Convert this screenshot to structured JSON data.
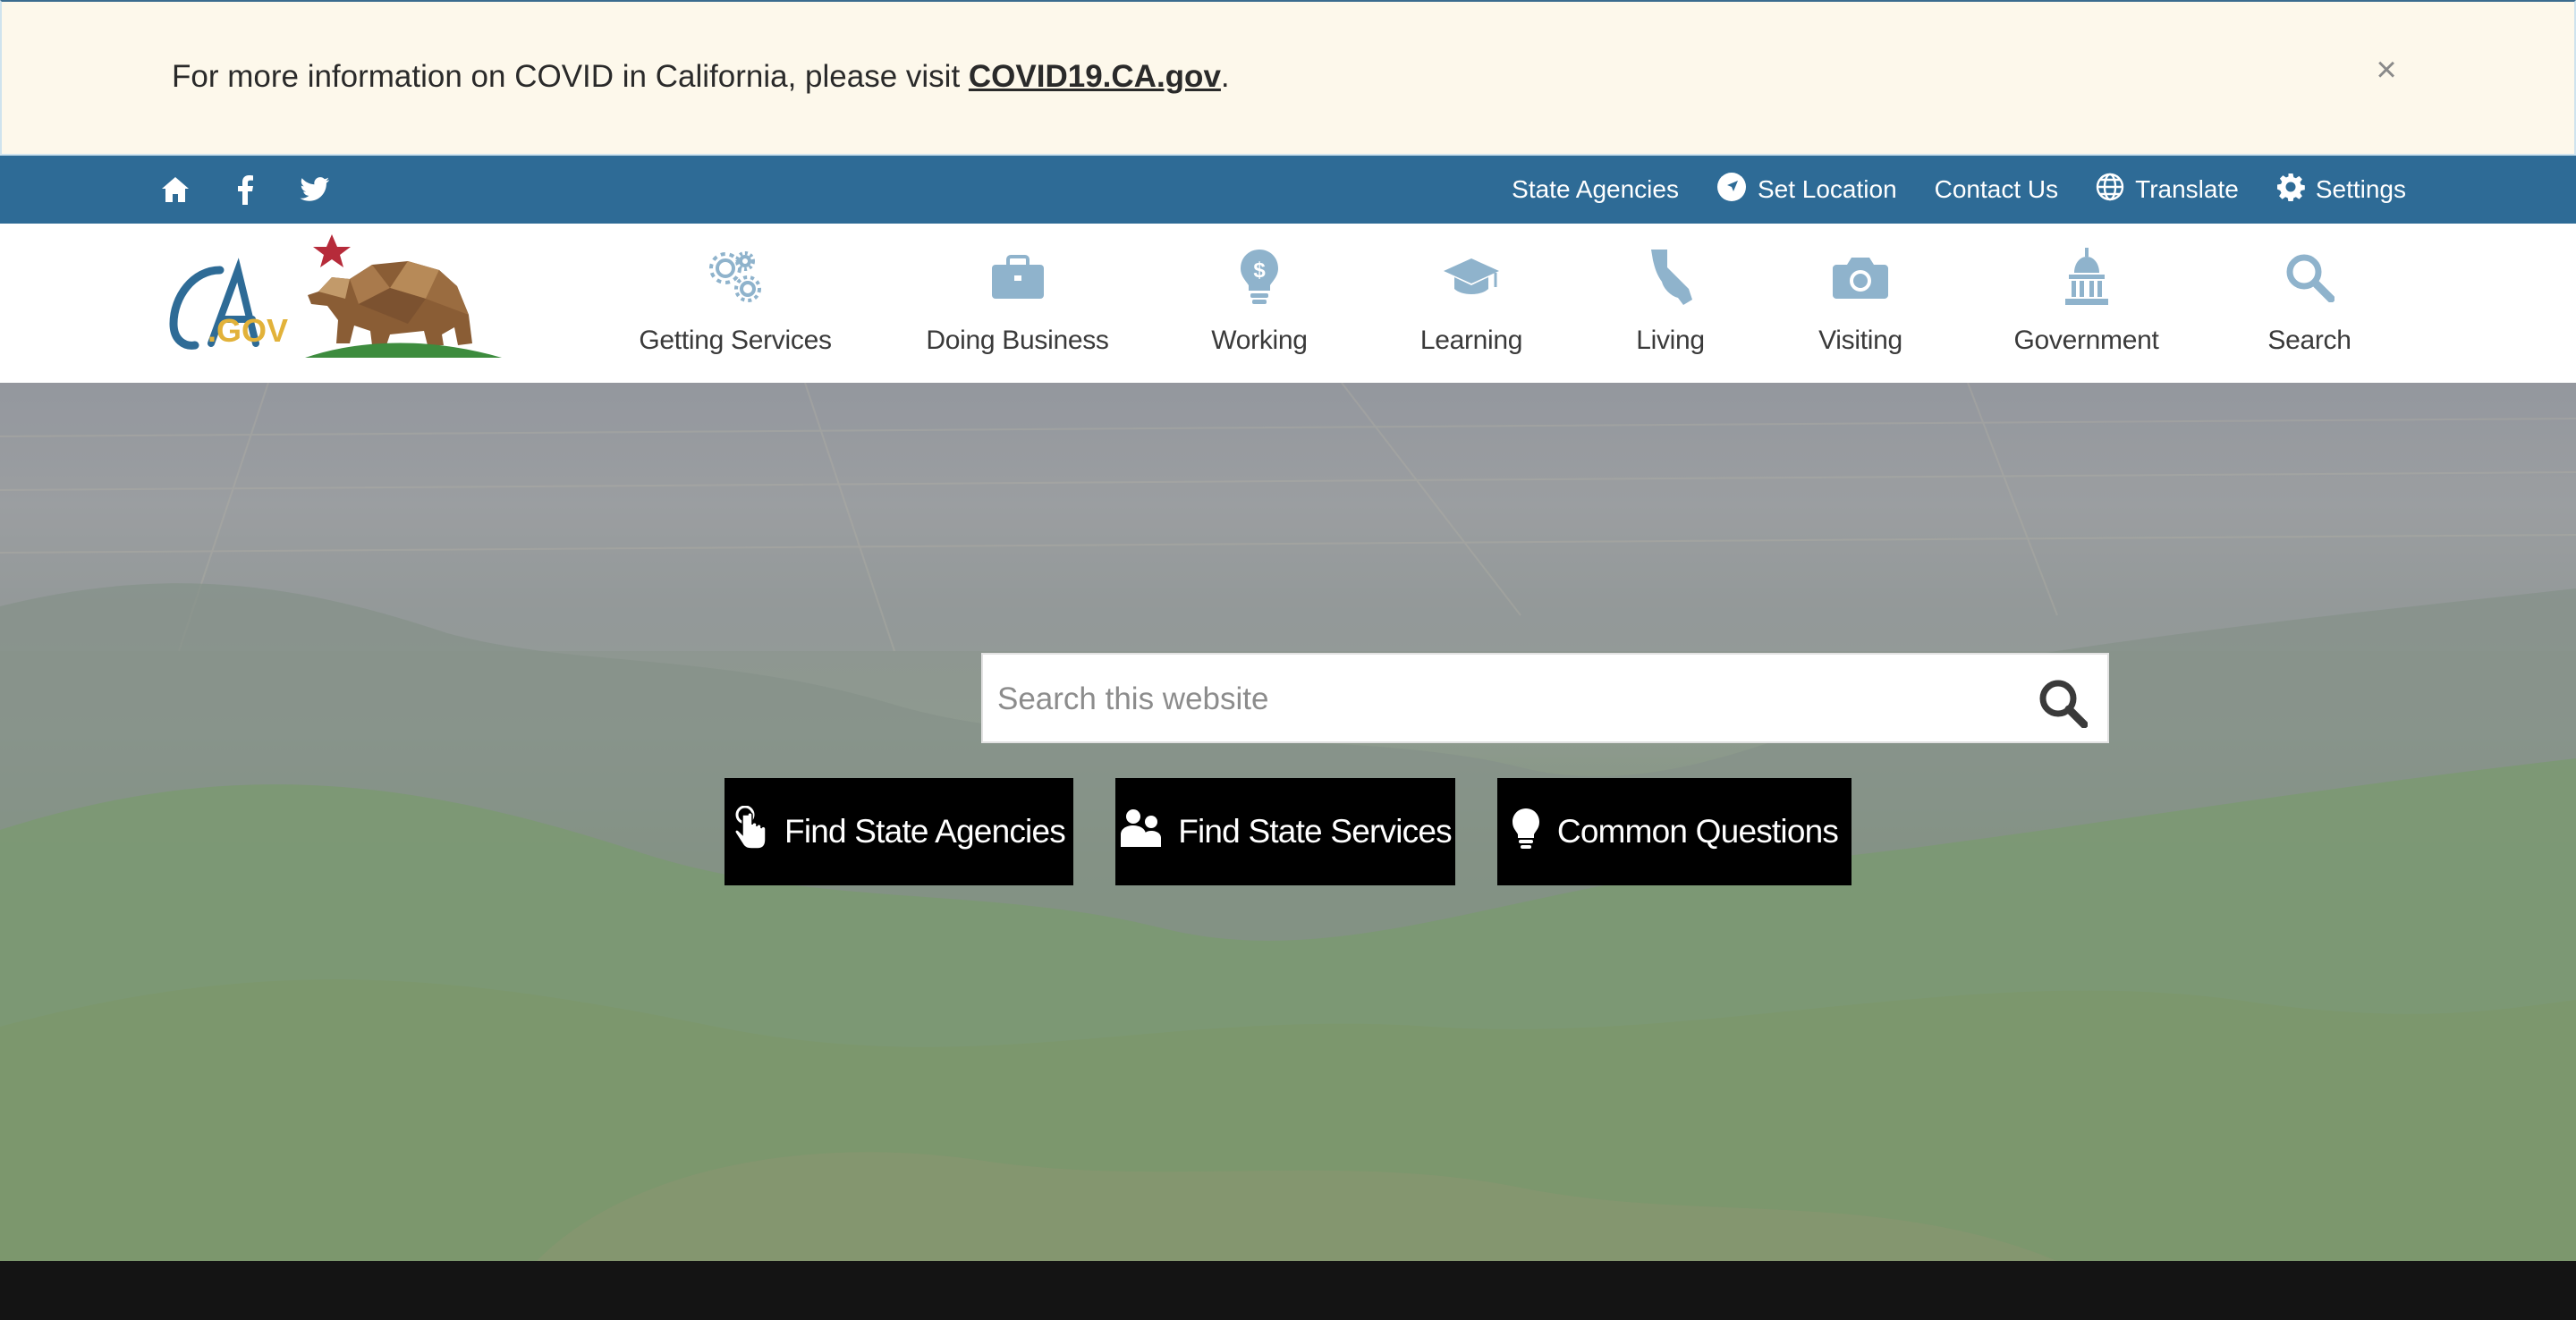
{
  "alert": {
    "message": "For more information on COVID in California, please visit ",
    "link_text": "COVID19.CA.gov",
    "trailing": ".",
    "close_symbol": "×"
  },
  "utility_bar": {
    "social_icons": [
      "home-icon",
      "facebook-icon",
      "twitter-icon"
    ],
    "links": {
      "state_agencies": "State Agencies",
      "set_location": "Set Location",
      "contact_us": "Contact Us",
      "translate": "Translate",
      "settings": "Settings"
    }
  },
  "nav": {
    "getting_services": "Getting Services",
    "doing_business": "Doing Business",
    "working": "Working",
    "learning": "Learning",
    "living": "Living",
    "visiting": "Visiting",
    "government": "Government",
    "search": "Search"
  },
  "logo": {
    "text_ca": "CA",
    "text_gov": ".GOV"
  },
  "hero": {
    "search_placeholder": "Search this website",
    "buttons": {
      "find_agencies": "Find State Agencies",
      "find_services": "Find State Services",
      "common_questions": "Common Questions"
    }
  },
  "colors": {
    "utility_bar": "#2e6b96",
    "alert_bg": "#fdf8eb",
    "nav_icon": "#8fb3cc",
    "cta_bg": "#000000",
    "logo_blue": "#2e6b96",
    "logo_gold": "#e2b23a"
  }
}
